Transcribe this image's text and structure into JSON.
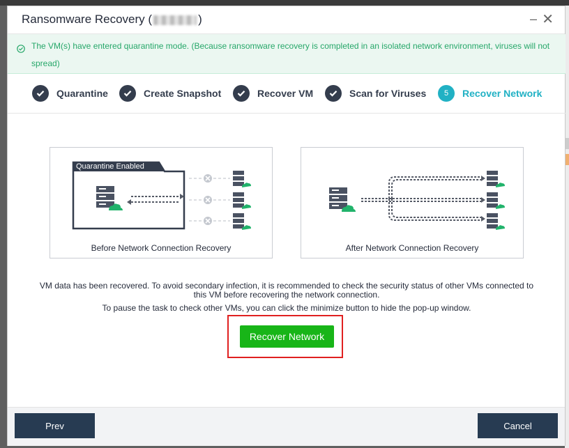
{
  "dialog": {
    "title": "Ransomware Recovery (",
    "title_suffix": ")",
    "minimize_symbol": "–",
    "close_symbol": "✕"
  },
  "alert": {
    "text": "The VM(s) have entered quarantine mode. (Because ransomware recovery is completed in an isolated network environment, viruses will not spread)",
    "icon": "check-circle-icon",
    "color": "#26a769"
  },
  "steps": [
    {
      "label": "Quarantine",
      "state": "done"
    },
    {
      "label": "Create Snapshot",
      "state": "done"
    },
    {
      "label": "Recover VM",
      "state": "done"
    },
    {
      "label": "Scan for Viruses",
      "state": "done"
    },
    {
      "label": "Recover Network",
      "state": "active",
      "number": "5"
    }
  ],
  "diagrams": {
    "before": {
      "badge": "Quarantine Enabled",
      "caption": "Before Network Connection Recovery"
    },
    "after": {
      "caption": "After Network Connection Recovery"
    }
  },
  "main": {
    "info_line1": "VM data has been recovered. To avoid secondary infection, it is recommended to check the security status of other VMs connected to",
    "info_line2": "this VM before recovering the network connection.",
    "info_line3": "To pause the task to check other VMs, you can click the minimize button to hide the pop-up window.",
    "recover_button": "Recover Network"
  },
  "footer": {
    "prev_label": "Prev",
    "cancel_label": "Cancel"
  },
  "colors": {
    "accent": "#21b1c4",
    "primary_dark": "#273b52",
    "success_green": "#18b518",
    "highlight_red": "#e02020"
  }
}
